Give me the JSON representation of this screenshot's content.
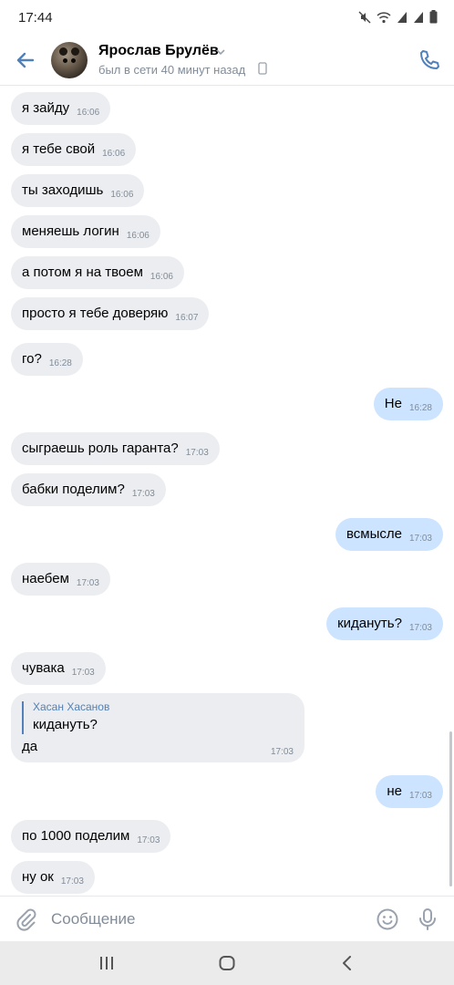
{
  "status_bar": {
    "time": "17:44",
    "icons": [
      "mute-icon",
      "wifi-icon",
      "signal-icon",
      "signal-icon",
      "battery-icon"
    ]
  },
  "header": {
    "contact_name": "Ярослав Брулёв",
    "status": "был в сети 40 минут назад",
    "icons": [
      "back-arrow-icon",
      "chevron-down-icon",
      "mobile-phone-icon",
      "call-icon"
    ],
    "accent_color": "#5181b8"
  },
  "messages": [
    {
      "dir": "in",
      "text": "я зайду",
      "time": "16:06"
    },
    {
      "dir": "in",
      "text": "я тебе свой",
      "time": "16:06"
    },
    {
      "dir": "in",
      "text": "ты заходишь",
      "time": "16:06"
    },
    {
      "dir": "in",
      "text": "меняешь логин",
      "time": "16:06"
    },
    {
      "dir": "in",
      "text": "а потом я на твоем",
      "time": "16:06"
    },
    {
      "dir": "in",
      "text": "просто я тебе доверяю",
      "time": "16:07"
    },
    {
      "dir": "in",
      "text": "го?",
      "time": "16:28"
    },
    {
      "dir": "out",
      "text": "Не",
      "time": "16:28"
    },
    {
      "dir": "in",
      "text": "сыграешь роль гаранта?",
      "time": "17:03"
    },
    {
      "dir": "in",
      "text": "бабки поделим?",
      "time": "17:03"
    },
    {
      "dir": "out",
      "text": "всмысле",
      "time": "17:03"
    },
    {
      "dir": "in",
      "text": "наебем",
      "time": "17:03"
    },
    {
      "dir": "out",
      "text": "кидануть?",
      "time": "17:03"
    },
    {
      "dir": "in",
      "text": "чувака",
      "time": "17:03"
    },
    {
      "dir": "in",
      "reply_author": "Хасан Хасанов",
      "reply_text": "кидануть?",
      "text": "да",
      "time": "17:03"
    },
    {
      "dir": "out",
      "text": "не",
      "time": "17:03"
    },
    {
      "dir": "in",
      "text": "по 1000 поделим",
      "time": "17:03"
    },
    {
      "dir": "in",
      "text": "ну ок",
      "time": "17:03"
    }
  ],
  "composer": {
    "placeholder": "Сообщение",
    "icons": [
      "paperclip-icon",
      "emoji-icon",
      "microphone-icon"
    ]
  },
  "nav_bar": {
    "icons": [
      "recent-apps-icon",
      "home-icon",
      "back-icon"
    ]
  },
  "colors": {
    "incoming_bubble": "#ebedf0",
    "outgoing_bubble": "#cce4ff",
    "timestamp": "#818c99"
  }
}
